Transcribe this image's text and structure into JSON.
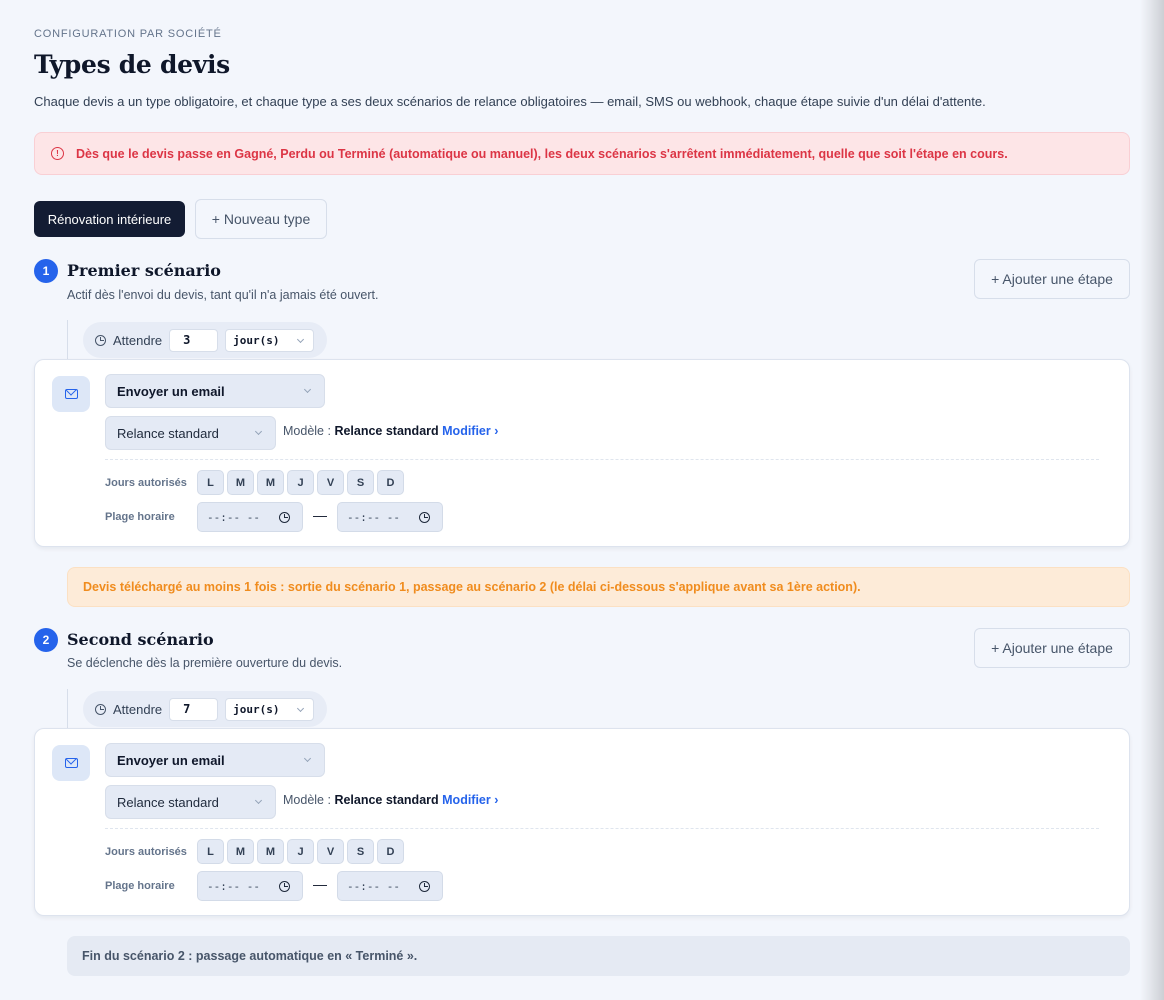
{
  "header": {
    "eyebrow": "CONFIGURATION PAR SOCIÉTÉ",
    "title": "Types de devis",
    "subtitle": "Chaque devis a un type obligatoire, et chaque type a ses deux scénarios de relance obligatoires — email, SMS ou webhook, chaque étape suivie d'un délai d'attente."
  },
  "alert": {
    "icon": "alert-circle-icon",
    "text": "Dès que le devis passe en Gagné, Perdu ou Terminé (automatique ou manuel), les deux scénarios s'arrêtent immédiatement, quelle que soit l'étape en cours."
  },
  "tabs": {
    "active": "Rénovation intérieure",
    "new": "+ Nouveau type"
  },
  "scenarios": [
    {
      "number": "1",
      "title": "Premier scénario",
      "description": "Actif dès l'envoi du devis, tant qu'il n'a jamais été ouvert.",
      "add_step": "+ Ajouter une étape",
      "wait": {
        "label": "Attendre",
        "value": "3",
        "unit": "jour(s)"
      },
      "step": {
        "icon": "mail-icon",
        "action": "Envoyer un email",
        "template": "Relance standard",
        "model_label": "Modèle :",
        "model_name": "Relance standard",
        "model_link": "Modifier ›",
        "days_label": "Jours autorisés",
        "days": [
          "L",
          "M",
          "M",
          "J",
          "V",
          "S",
          "D"
        ],
        "hours_label": "Plage horaire",
        "start_time": "--:-- --",
        "end_time": "--:-- --",
        "separator": "—"
      }
    },
    {
      "number": "2",
      "title": "Second scénario",
      "description": "Se déclenche dès la première ouverture du devis.",
      "add_step": "+ Ajouter une étape",
      "wait": {
        "label": "Attendre",
        "value": "7",
        "unit": "jour(s)"
      },
      "step": {
        "icon": "mail-icon",
        "action": "Envoyer un email",
        "template": "Relance standard",
        "model_label": "Modèle :",
        "model_name": "Relance standard",
        "model_link": "Modifier ›",
        "days_label": "Jours autorisés",
        "days": [
          "L",
          "M",
          "M",
          "J",
          "V",
          "S",
          "D"
        ],
        "hours_label": "Plage horaire",
        "start_time": "--:-- --",
        "end_time": "--:-- --",
        "separator": "—"
      }
    }
  ],
  "transition_note": "Devis téléchargé au moins 1 fois : sortie du scénario 1, passage au scénario 2 (le délai ci-dessous s'applique avant sa 1ère action).",
  "end_note": "Fin du scénario 2 : passage automatique en « Terminé ».",
  "colors": {
    "background": "#f3f6fc",
    "accent": "#2563eb",
    "danger": "#dc3545",
    "warning": "#f08c1e",
    "tab_active": "#131c33"
  }
}
